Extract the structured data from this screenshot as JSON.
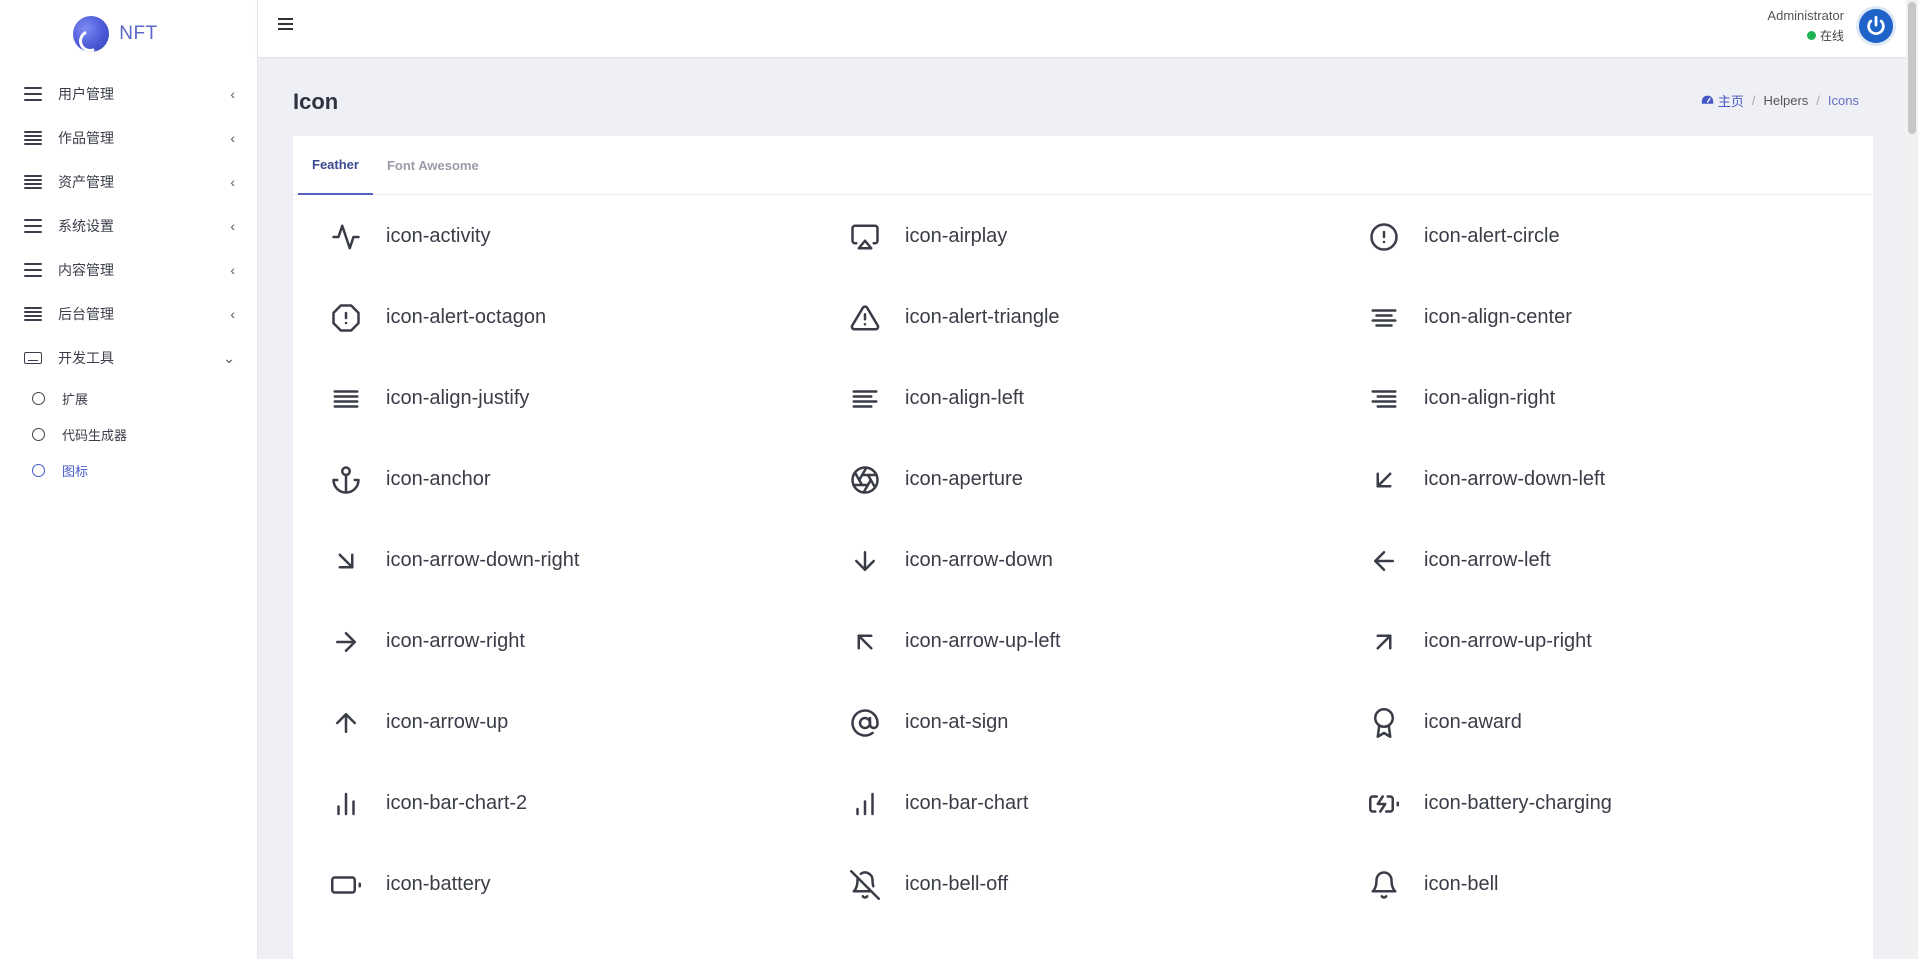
{
  "brand": {
    "name": "NFT"
  },
  "sidebar": {
    "items": [
      {
        "label": "用户管理",
        "icon": "bars-icon"
      },
      {
        "label": "作品管理",
        "icon": "bars-dense-icon"
      },
      {
        "label": "资产管理",
        "icon": "bars-dense-icon"
      },
      {
        "label": "系统设置",
        "icon": "bars-icon"
      },
      {
        "label": "内容管理",
        "icon": "bars-icon"
      },
      {
        "label": "后台管理",
        "icon": "server-icon"
      },
      {
        "label": "开发工具",
        "icon": "keyboard-icon",
        "expanded": true
      }
    ],
    "subitems": [
      {
        "label": "扩展"
      },
      {
        "label": "代码生成器"
      },
      {
        "label": "图标",
        "active": true
      }
    ]
  },
  "user": {
    "name": "Administrator",
    "status": "在线",
    "status_color": "#1fb355"
  },
  "page": {
    "title": "Icon"
  },
  "breadcrumb": {
    "home": "主页",
    "level2": "Helpers",
    "current": "Icons"
  },
  "tabs": [
    {
      "label": "Feather",
      "active": true
    },
    {
      "label": "Font Awesome",
      "active": false
    }
  ],
  "icons": [
    {
      "name": "icon-activity",
      "glyph": "activity"
    },
    {
      "name": "icon-airplay",
      "glyph": "airplay"
    },
    {
      "name": "icon-alert-circle",
      "glyph": "alert-circle"
    },
    {
      "name": "icon-alert-octagon",
      "glyph": "alert-octagon"
    },
    {
      "name": "icon-alert-triangle",
      "glyph": "alert-triangle"
    },
    {
      "name": "icon-align-center",
      "glyph": "align-center"
    },
    {
      "name": "icon-align-justify",
      "glyph": "align-justify"
    },
    {
      "name": "icon-align-left",
      "glyph": "align-left"
    },
    {
      "name": "icon-align-right",
      "glyph": "align-right"
    },
    {
      "name": "icon-anchor",
      "glyph": "anchor"
    },
    {
      "name": "icon-aperture",
      "glyph": "aperture"
    },
    {
      "name": "icon-arrow-down-left",
      "glyph": "arrow-down-left"
    },
    {
      "name": "icon-arrow-down-right",
      "glyph": "arrow-down-right"
    },
    {
      "name": "icon-arrow-down",
      "glyph": "arrow-down"
    },
    {
      "name": "icon-arrow-left",
      "glyph": "arrow-left"
    },
    {
      "name": "icon-arrow-right",
      "glyph": "arrow-right"
    },
    {
      "name": "icon-arrow-up-left",
      "glyph": "arrow-up-left"
    },
    {
      "name": "icon-arrow-up-right",
      "glyph": "arrow-up-right"
    },
    {
      "name": "icon-arrow-up",
      "glyph": "arrow-up"
    },
    {
      "name": "icon-at-sign",
      "glyph": "at-sign"
    },
    {
      "name": "icon-award",
      "glyph": "award"
    },
    {
      "name": "icon-bar-chart-2",
      "glyph": "bar-chart-2"
    },
    {
      "name": "icon-bar-chart",
      "glyph": "bar-chart"
    },
    {
      "name": "icon-battery-charging",
      "glyph": "battery-charging"
    },
    {
      "name": "icon-battery",
      "glyph": "battery"
    },
    {
      "name": "icon-bell-off",
      "glyph": "bell-off"
    },
    {
      "name": "icon-bell",
      "glyph": "bell"
    }
  ]
}
